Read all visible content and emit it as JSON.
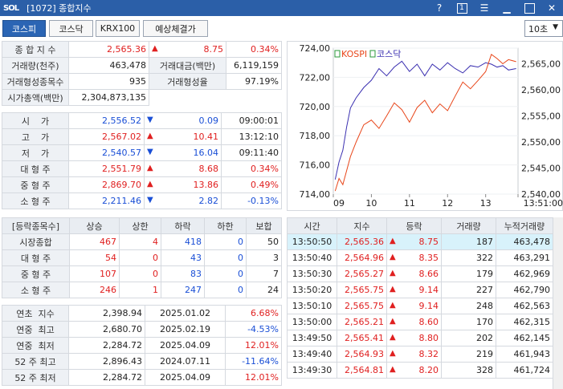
{
  "window": {
    "logo": "SOL",
    "title": "[1072] 종합지수",
    "help": "?",
    "page": "1"
  },
  "tabs": [
    {
      "label": "코스피",
      "active": true
    },
    {
      "label": "코스닥",
      "active": false
    },
    {
      "label": "KRX100",
      "active": false
    },
    {
      "label": "예상체결가",
      "active": false
    }
  ],
  "interval": {
    "value": "10초"
  },
  "summary": {
    "index_label": "종 합 지 수",
    "index_value": "2,565.36",
    "index_change": "8.75",
    "index_rate": "0.34%",
    "volume_label": "거래량(천주)",
    "volume_value": "463,478",
    "amount_label": "거래대금(백만)",
    "amount_value": "6,119,159",
    "formed_cnt_label": "거래형성종목수",
    "formed_cnt_value": "935",
    "formed_rate_label": "거래형성율",
    "formed_rate_value": "97.19%",
    "mktcap_label": "시가총액(백만)",
    "mktcap_value": "2,304,873,135"
  },
  "prices": [
    {
      "label": "시    가",
      "value": "2,556.52",
      "dir": "down",
      "change": "0.09",
      "extra": "09:00:01",
      "extra_color": ""
    },
    {
      "label": "고    가",
      "value": "2,567.02",
      "dir": "up",
      "change": "10.41",
      "extra": "13:12:10",
      "extra_color": ""
    },
    {
      "label": "저    가",
      "value": "2,540.57",
      "dir": "down",
      "change": "16.04",
      "extra": "09:11:40",
      "extra_color": ""
    },
    {
      "label": "대 형 주",
      "value": "2,551.79",
      "dir": "up",
      "change": "8.68",
      "extra": "0.34%",
      "extra_color": "red"
    },
    {
      "label": "중 형 주",
      "value": "2,869.70",
      "dir": "up",
      "change": "13.86",
      "extra": "0.49%",
      "extra_color": "red"
    },
    {
      "label": "소 형 주",
      "value": "2,211.46",
      "dir": "down",
      "change": "2.82",
      "extra": "-0.13%",
      "extra_color": "blue"
    }
  ],
  "updown": {
    "headers": [
      "[등락종목수]",
      "상승",
      "상한",
      "하락",
      "하한",
      "보합"
    ],
    "rows": [
      {
        "label": "시장종합",
        "up": "467",
        "upper": "4",
        "down": "418",
        "lower": "0",
        "flat": "50"
      },
      {
        "label": "대 형 주",
        "up": "54",
        "upper": "0",
        "down": "43",
        "lower": "0",
        "flat": "3"
      },
      {
        "label": "중 형 주",
        "up": "107",
        "upper": "0",
        "down": "83",
        "lower": "0",
        "flat": "7"
      },
      {
        "label": "소 형 주",
        "up": "246",
        "upper": "1",
        "down": "247",
        "lower": "0",
        "flat": "24"
      }
    ]
  },
  "yearly": [
    {
      "label": "연초  지수",
      "value": "2,398.94",
      "date": "2025.01.02",
      "rate": "6.68%",
      "color": "red"
    },
    {
      "label": "연중  최고",
      "value": "2,680.70",
      "date": "2025.02.19",
      "rate": "-4.53%",
      "color": "blue"
    },
    {
      "label": "연중  최저",
      "value": "2,284.72",
      "date": "2025.04.09",
      "rate": "12.01%",
      "color": "red"
    },
    {
      "label": "52 주 최고",
      "value": "2,896.43",
      "date": "2024.07.11",
      "rate": "-11.64%",
      "color": "blue"
    },
    {
      "label": "52 주 최저",
      "value": "2,284.72",
      "date": "2025.04.09",
      "rate": "12.01%",
      "color": "red"
    }
  ],
  "ticks": {
    "headers": [
      "시간",
      "지수",
      "등락",
      "거래량",
      "누적거래량"
    ],
    "rows": [
      {
        "time": "13:50:50",
        "index": "2,565.36",
        "change": "8.75",
        "vol": "187",
        "cum": "463,478",
        "selected": true
      },
      {
        "time": "13:50:40",
        "index": "2,564.96",
        "change": "8.35",
        "vol": "322",
        "cum": "463,291",
        "selected": false
      },
      {
        "time": "13:50:30",
        "index": "2,565.27",
        "change": "8.66",
        "vol": "179",
        "cum": "462,969",
        "selected": false
      },
      {
        "time": "13:50:20",
        "index": "2,565.75",
        "change": "9.14",
        "vol": "227",
        "cum": "462,790",
        "selected": false
      },
      {
        "time": "13:50:10",
        "index": "2,565.75",
        "change": "9.14",
        "vol": "248",
        "cum": "462,563",
        "selected": false
      },
      {
        "time": "13:50:00",
        "index": "2,565.21",
        "change": "8.60",
        "vol": "170",
        "cum": "462,315",
        "selected": false
      },
      {
        "time": "13:49:50",
        "index": "2,565.41",
        "change": "8.80",
        "vol": "202",
        "cum": "462,145",
        "selected": false
      },
      {
        "time": "13:49:40",
        "index": "2,564.93",
        "change": "8.32",
        "vol": "219",
        "cum": "461,943",
        "selected": false
      },
      {
        "time": "13:49:30",
        "index": "2,564.81",
        "change": "8.20",
        "vol": "328",
        "cum": "461,724",
        "selected": false
      }
    ]
  },
  "chart": {
    "legend": [
      {
        "name": "KOSPI",
        "color": "#e8461a"
      },
      {
        "name": "코스닥",
        "color": "#3a2fb0"
      }
    ],
    "left_axis": {
      "min": 714,
      "max": 724,
      "ticks": [
        "724,00",
        "722,00",
        "720,00",
        "718,00",
        "716,00",
        "714,00"
      ]
    },
    "right_axis": {
      "min": 2540,
      "max": 2568,
      "ticks": [
        "2,565,00",
        "2,560,00",
        "2,555,00",
        "2,550,00",
        "2,545,00",
        "2,540,00"
      ]
    },
    "x_ticks": [
      "09",
      "10",
      "11",
      "12",
      "13",
      "13:51:00"
    ],
    "x_range": [
      9,
      13.85
    ],
    "kosdaq": [
      [
        9.05,
        715.0
      ],
      [
        9.15,
        716.2
      ],
      [
        9.25,
        717.0
      ],
      [
        9.35,
        718.6
      ],
      [
        9.45,
        719.9
      ],
      [
        9.6,
        720.6
      ],
      [
        9.8,
        721.3
      ],
      [
        10.0,
        721.8
      ],
      [
        10.2,
        722.6
      ],
      [
        10.4,
        722.1
      ],
      [
        10.6,
        722.7
      ],
      [
        10.8,
        723.1
      ],
      [
        11.0,
        722.4
      ],
      [
        11.2,
        722.9
      ],
      [
        11.4,
        722.1
      ],
      [
        11.6,
        722.9
      ],
      [
        11.8,
        722.5
      ],
      [
        12.0,
        723.0
      ],
      [
        12.2,
        722.6
      ],
      [
        12.4,
        722.3
      ],
      [
        12.6,
        722.8
      ],
      [
        12.8,
        722.7
      ],
      [
        13.0,
        723.0
      ],
      [
        13.15,
        722.9
      ],
      [
        13.3,
        722.7
      ],
      [
        13.45,
        722.8
      ],
      [
        13.6,
        722.5
      ],
      [
        13.8,
        722.6
      ]
    ],
    "kospi": [
      [
        9.05,
        2540.6
      ],
      [
        9.15,
        2543.0
      ],
      [
        9.25,
        2541.8
      ],
      [
        9.35,
        2544.5
      ],
      [
        9.45,
        2547.2
      ],
      [
        9.6,
        2550.0
      ],
      [
        9.8,
        2553.3
      ],
      [
        10.0,
        2554.2
      ],
      [
        10.2,
        2552.6
      ],
      [
        10.4,
        2555.0
      ],
      [
        10.6,
        2557.5
      ],
      [
        10.8,
        2556.2
      ],
      [
        11.0,
        2553.8
      ],
      [
        11.2,
        2556.6
      ],
      [
        11.4,
        2558.0
      ],
      [
        11.6,
        2555.6
      ],
      [
        11.8,
        2557.3
      ],
      [
        12.0,
        2556.0
      ],
      [
        12.2,
        2558.8
      ],
      [
        12.4,
        2561.5
      ],
      [
        12.6,
        2560.2
      ],
      [
        12.8,
        2561.8
      ],
      [
        13.0,
        2563.5
      ],
      [
        13.15,
        2566.8
      ],
      [
        13.3,
        2566.0
      ],
      [
        13.45,
        2565.0
      ],
      [
        13.6,
        2565.8
      ],
      [
        13.8,
        2565.4
      ]
    ]
  }
}
